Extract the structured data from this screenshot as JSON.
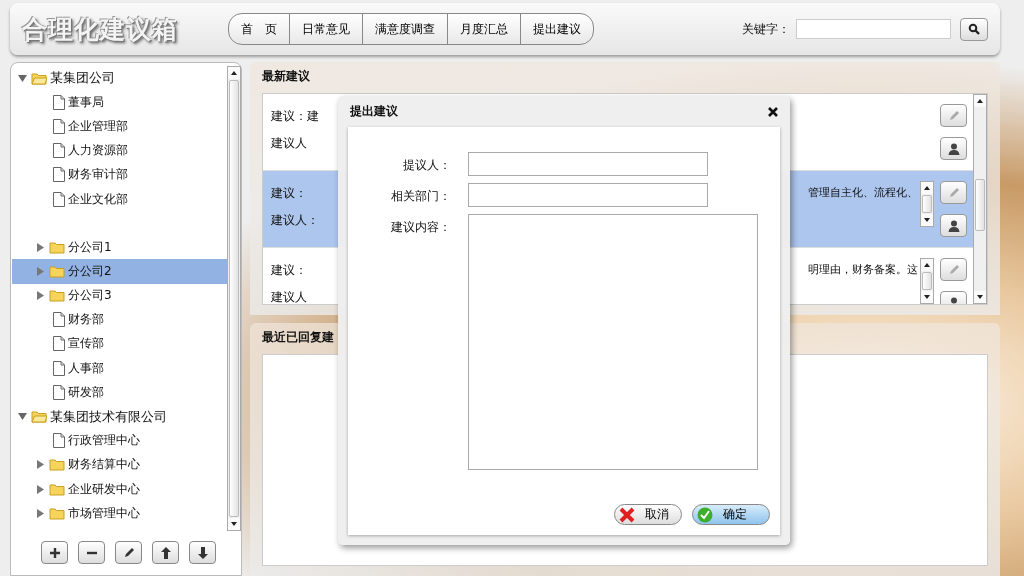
{
  "header": {
    "logo": "合理化建议箱",
    "nav": [
      {
        "label": "首　页"
      },
      {
        "label": "日常意见"
      },
      {
        "label": "满意度调查"
      },
      {
        "label": "月度汇总"
      },
      {
        "label": "提出建议"
      }
    ],
    "search": {
      "label": "关键字："
    }
  },
  "tree": [
    {
      "label": "某集团公司",
      "kind": "folder",
      "expanded": true,
      "selected": false,
      "children": [
        {
          "label": "董事局",
          "kind": "file",
          "selected": false
        },
        {
          "label": "企业管理部",
          "kind": "file",
          "selected": false
        },
        {
          "label": "人力资源部",
          "kind": "file",
          "selected": false
        },
        {
          "label": "财务审计部",
          "kind": "file",
          "selected": false
        },
        {
          "label": "企业文化部",
          "kind": "file",
          "selected": false
        },
        {
          "kind": "gap"
        },
        {
          "label": "分公司1",
          "kind": "folder",
          "expanded": false,
          "selected": false
        },
        {
          "label": "分公司2",
          "kind": "folder",
          "expanded": false,
          "selected": true
        },
        {
          "label": "分公司3",
          "kind": "folder",
          "expanded": false,
          "selected": false
        },
        {
          "label": "财务部",
          "kind": "file",
          "selected": false
        },
        {
          "label": "宣传部",
          "kind": "file",
          "selected": false
        },
        {
          "label": "人事部",
          "kind": "file",
          "selected": false
        },
        {
          "label": "研发部",
          "kind": "file",
          "selected": false
        }
      ]
    },
    {
      "label": "某集团技术有限公司",
      "kind": "folder",
      "expanded": true,
      "selected": false,
      "children": [
        {
          "label": "行政管理中心",
          "kind": "file",
          "selected": false
        },
        {
          "label": "财务结算中心",
          "kind": "folder",
          "expanded": false,
          "selected": false
        },
        {
          "label": "企业研发中心",
          "kind": "folder",
          "expanded": false,
          "selected": false
        },
        {
          "label": "市场管理中心",
          "kind": "folder",
          "expanded": false,
          "selected": false
        }
      ]
    }
  ],
  "tree_buttons": [
    {
      "kind": "add"
    },
    {
      "kind": "remove"
    },
    {
      "kind": "edit"
    },
    {
      "kind": "up"
    },
    {
      "kind": "down"
    }
  ],
  "latest": {
    "title": "最新建议",
    "rows": [
      {
        "lead": "建议：建",
        "tail": "",
        "proposer": "建议人",
        "selected": false,
        "scroll": false
      },
      {
        "lead": "建议：",
        "tail": "管理自主化、流程化、",
        "proposer": "建议人：",
        "selected": true,
        "scroll": true
      },
      {
        "lead": "建议：",
        "tail": "明理由，财务备案。这",
        "proposer": "建议人",
        "selected": false,
        "scroll": true
      }
    ]
  },
  "replied": {
    "title": "最近已回复建"
  },
  "dialog": {
    "title": "提出建议",
    "fields": [
      {
        "label": "提议人：",
        "kind": "input"
      },
      {
        "label": "相关部门：",
        "kind": "input"
      },
      {
        "label": "建议内容：",
        "kind": "textarea"
      }
    ],
    "buttons": [
      {
        "label": "取消",
        "kind": "cancel"
      },
      {
        "label": "确定",
        "kind": "ok"
      }
    ]
  }
}
